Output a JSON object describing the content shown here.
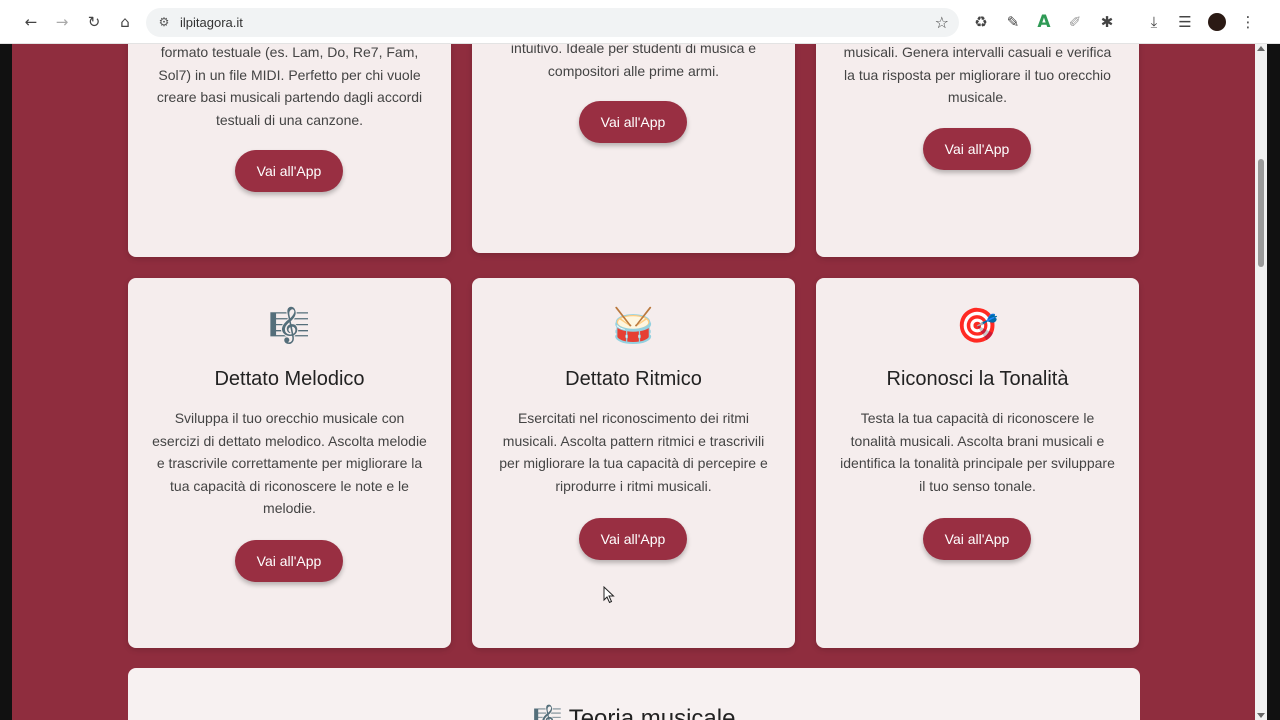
{
  "browser": {
    "url": "ilpitagora.it",
    "icons": {
      "back": "arrow-left-icon",
      "forward": "arrow-right-icon",
      "reload": "reload-icon",
      "home": "home-icon",
      "site_info": "tune-icon",
      "bookmark": "star-icon",
      "extensions": [
        "recycle-icon",
        "pen-icon",
        "a-letter-icon",
        "edit-icon",
        "puzzle-icon",
        "download-icon",
        "reading-list-icon",
        "profile-avatar",
        "more-vert-icon"
      ]
    }
  },
  "colors": {
    "page_background": "#8f2d3e",
    "card_background": "#f5eded",
    "button_background": "#992f42",
    "button_text": "#ffffff"
  },
  "cards_top_row": [
    {
      "description_lines": [
        "formato testuale (es. Lam, Do, Re7, Fam,",
        "Sol7) in un file MIDI. Perfetto per chi vuole",
        "creare basi musicali partendo dagli accordi",
        "testuali di una canzone."
      ],
      "button": "Vai all'App"
    },
    {
      "description_lines": [
        "intuitivo. Ideale per studenti di musica e",
        "compositori alle prime armi."
      ],
      "button": "Vai all'App"
    },
    {
      "description_lines": [
        "musicali. Genera intervalli casuali e verifica",
        "la tua risposta per migliorare il tuo orecchio",
        "musicale."
      ],
      "button": "Vai all'App"
    }
  ],
  "cards_middle_row": [
    {
      "icon": "musical-score-icon",
      "icon_glyph": "🎼",
      "title": "Dettato Melodico",
      "description_lines": [
        "Sviluppa il tuo orecchio musicale con",
        "esercizi di dettato melodico. Ascolta melodie",
        "e trascrivile correttamente per migliorare la",
        "tua capacità di riconoscere le note e le",
        "melodie."
      ],
      "button": "Vai all'App"
    },
    {
      "icon": "drum-icon",
      "icon_glyph": "🥁",
      "title": "Dettato Ritmico",
      "description_lines": [
        "Esercitati nel riconoscimento dei ritmi",
        "musicali. Ascolta pattern ritmici e trascrivili",
        "per migliorare la tua capacità di percepire e",
        "riprodurre i ritmi musicali."
      ],
      "button": "Vai all'App"
    },
    {
      "icon": "target-icon",
      "icon_glyph": "🎯",
      "title": "Riconosci la Tonalità",
      "description_lines": [
        "Testa la tua capacità di riconoscere le",
        "tonalità musicali. Ascolta brani musicali e",
        "identifica la tonalità principale per sviluppare",
        "il tuo senso tonale."
      ],
      "button": "Vai all'App"
    }
  ],
  "bottom_section": {
    "icon": "musical-score-icon",
    "icon_glyph": "🎼",
    "title": "Teoria musicale"
  }
}
